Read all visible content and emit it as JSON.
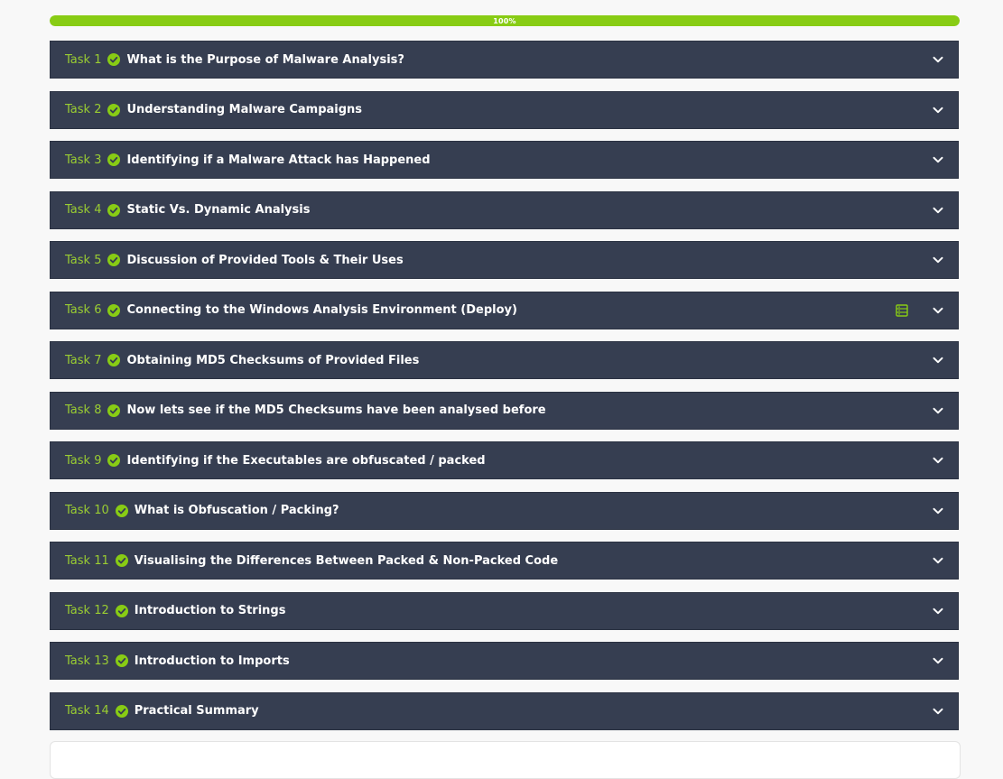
{
  "progress": {
    "label": "100%",
    "value": 100,
    "color": "#88cc14"
  },
  "colors": {
    "task_bg": "#363e51",
    "task_number": "#9acd32",
    "task_title": "#ffffff",
    "check": "#88cc14"
  },
  "tasks": [
    {
      "number": "Task 1",
      "title": "What is the Purpose of Malware Analysis?",
      "completed": true
    },
    {
      "number": "Task 2",
      "title": "Understanding Malware Campaigns",
      "completed": true
    },
    {
      "number": "Task 3",
      "title": "Identifying if a Malware Attack has Happened",
      "completed": true
    },
    {
      "number": "Task 4",
      "title": "Static Vs. Dynamic Analysis",
      "completed": true
    },
    {
      "number": "Task 5",
      "title": "Discussion of Provided Tools & Their Uses",
      "completed": true
    },
    {
      "number": "Task 6",
      "title": "Connecting to the Windows Analysis Environment (Deploy)",
      "completed": true,
      "icon": "server-icon"
    },
    {
      "number": "Task 7",
      "title": "Obtaining MD5 Checksums of Provided Files",
      "completed": true
    },
    {
      "number": "Task 8",
      "title": "Now lets see if the MD5 Checksums have been analysed before",
      "completed": true
    },
    {
      "number": "Task 9",
      "title": "Identifying if the Executables are obfuscated / packed",
      "completed": true
    },
    {
      "number": "Task 10",
      "title": "What is Obfuscation / Packing?",
      "completed": true
    },
    {
      "number": "Task 11",
      "title": "Visualising the Differences Between Packed & Non-Packed Code",
      "completed": true
    },
    {
      "number": "Task 12",
      "title": "Introduction to Strings",
      "completed": true
    },
    {
      "number": "Task 13",
      "title": "Introduction to Imports",
      "completed": true
    },
    {
      "number": "Task 14",
      "title": "Practical Summary",
      "completed": true
    }
  ]
}
